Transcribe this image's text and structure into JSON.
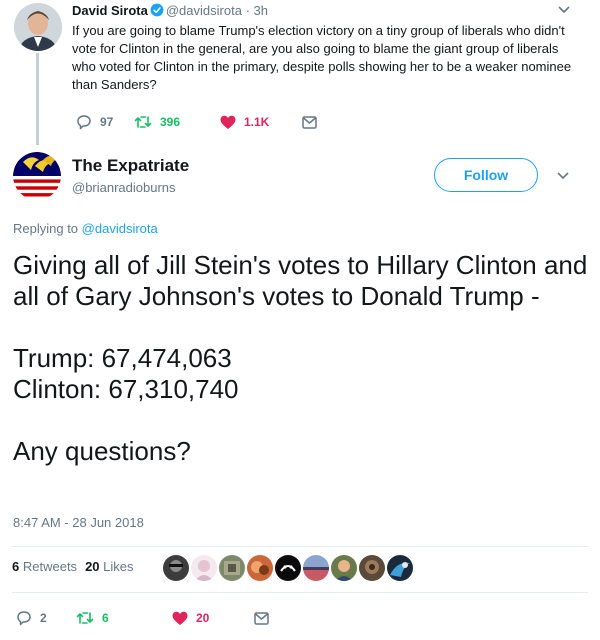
{
  "parent_tweet": {
    "name": "David Sirota",
    "handle": "@davidsirota",
    "separator": "·",
    "time": "3h",
    "text": "If you are going to blame Trump's election victory on a tiny group of liberals who didn't vote for Clinton in the general, are you also going to blame the giant group of liberals who voted for Clinton in the primary, despite polls showing her to be a weaker nominee than Sanders?",
    "replies": "97",
    "retweets": "396",
    "likes": "1.1K"
  },
  "main_tweet": {
    "name": "The Expatriate",
    "handle": "@brianradioburns",
    "follow_label": "Follow",
    "replying_prefix": "Replying to",
    "replying_to": "@davidsirota",
    "lines": [
      "Giving all of Jill Stein's votes to Hillary Clinton and all of Gary Johnson's votes to Donald Trump -",
      "Trump: 67,474,063",
      "Clinton: 67,310,740",
      "Any questions?"
    ],
    "timestamp": "8:47 AM - 28 Jun 2018",
    "retweet_count": "6",
    "retweet_label": "Retweets",
    "like_count": "20",
    "like_label": "Likes",
    "replies": "2",
    "retweets": "6",
    "likes": "20"
  },
  "colors": {
    "accent": "#1da1f2",
    "retweet": "#17bf63",
    "like": "#e0245e",
    "muted": "#657786"
  }
}
